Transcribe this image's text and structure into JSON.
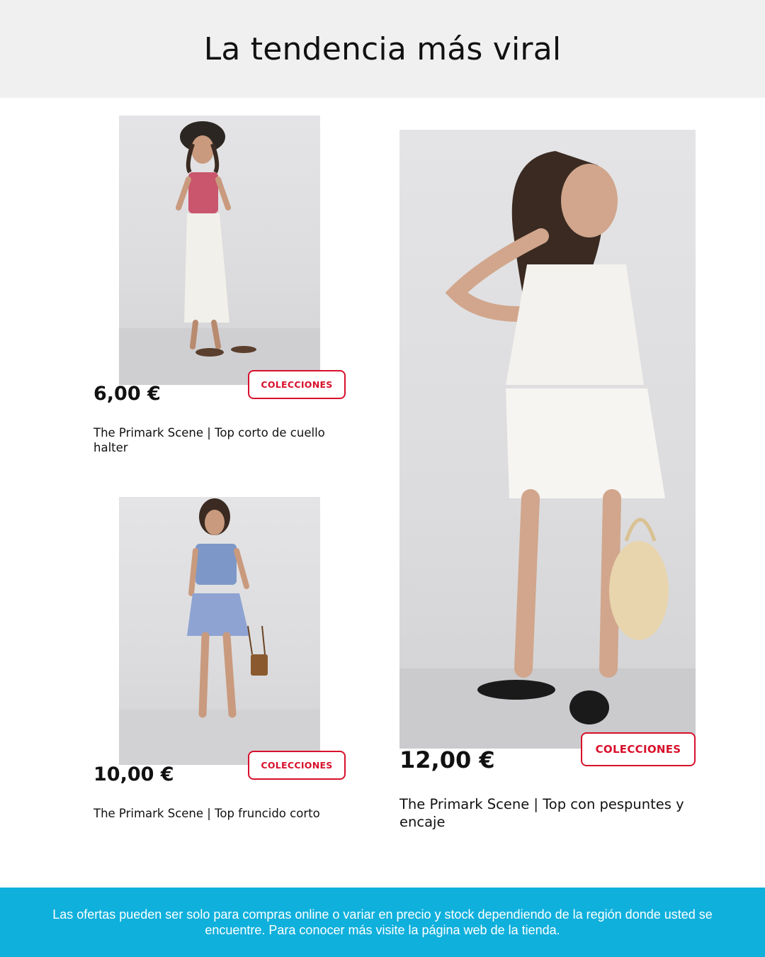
{
  "header": {
    "title": "La tendencia más viral"
  },
  "products": [
    {
      "price": "6,00 €",
      "description": "The Primark Scene | Top corto de cuello halter",
      "button_label": "COLECCIONES"
    },
    {
      "price": "10,00 €",
      "description": "The Primark Scene | Top fruncido corto",
      "button_label": "COLECCIONES"
    },
    {
      "price": "12,00 €",
      "description": "The Primark Scene | Top con pespuntes y encaje",
      "button_label": "COLECCIONES"
    }
  ],
  "footer": {
    "disclaimer": "Las ofertas pueden ser solo para compras online o variar en precio y stock dependiendo de la región donde usted se encuentre. Para conocer más visite la página web de la tienda."
  },
  "colors": {
    "header_bg": "#f0f0f0",
    "accent_red": "#d8102b",
    "footer_bg": "#0fb0dc"
  }
}
